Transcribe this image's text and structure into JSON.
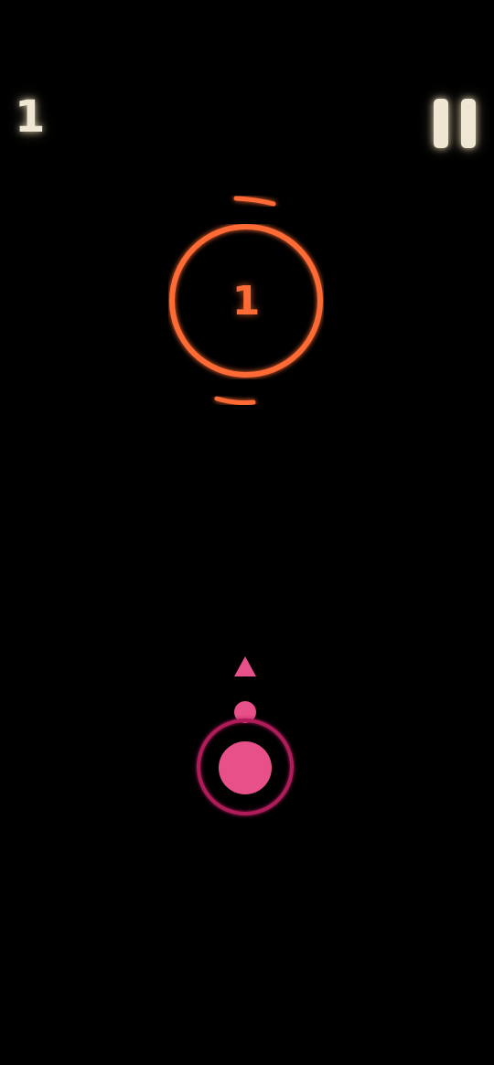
{
  "hud": {
    "score": "1",
    "pause_label": ""
  },
  "target": {
    "hits_remaining": "1"
  },
  "colors": {
    "background": "#000000",
    "hud": "#efe6d4",
    "target": "#ff6b35",
    "player": "#e8508a",
    "player_ring": "#b01e5a"
  },
  "icons": {
    "pause": "pause-icon",
    "aim": "aim-arrow-icon"
  }
}
